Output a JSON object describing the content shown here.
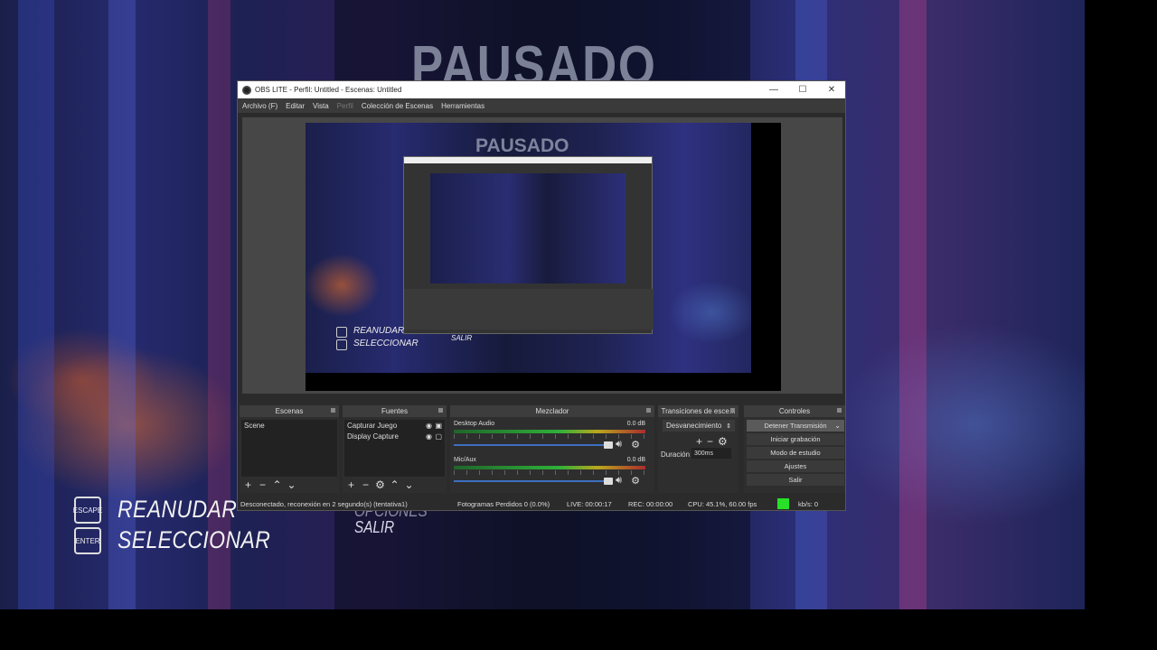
{
  "game": {
    "title": "PAUSADO",
    "menu": [
      {
        "key": "ESCAPE",
        "label": "REANUDAR"
      },
      {
        "key": "ENTER",
        "label": "SELECCIONAR"
      }
    ],
    "options_partial": "OPCIONES",
    "exit_label": "SALIR"
  },
  "obs": {
    "window_title": "OBS LITE - Perfil: Untitled - Escenas: Untitled",
    "window_controls": {
      "minimize": "—",
      "maximize": "☐",
      "close": "✕"
    },
    "menu": [
      {
        "label": "Archivo (F)",
        "enabled": true
      },
      {
        "label": "Editar",
        "enabled": true
      },
      {
        "label": "Vista",
        "enabled": true
      },
      {
        "label": "Perfil",
        "enabled": false
      },
      {
        "label": "Colección de Escenas",
        "enabled": true
      },
      {
        "label": "Herramientas",
        "enabled": true
      }
    ],
    "preview": {
      "title": "PAUSADO",
      "menu": [
        {
          "label": "REANUDAR"
        },
        {
          "label": "SELECCIONAR"
        }
      ],
      "exit_label": "SALIR"
    },
    "scenes": {
      "header": "Escenas",
      "items": [
        "Scene"
      ]
    },
    "sources": {
      "header": "Fuentes",
      "items": [
        "Capturar Juego",
        "Display Capture"
      ]
    },
    "mixer": {
      "header": "Mezclador",
      "channels": [
        {
          "name": "Desktop Audio",
          "db": "0.0 dB"
        },
        {
          "name": "Mic/Aux",
          "db": "0.0 dB"
        }
      ]
    },
    "transitions": {
      "header": "Transiciones de esce...",
      "selected": "Desvanecimiento",
      "duration_label": "Duración",
      "duration_value": "300ms"
    },
    "controls": {
      "header": "Controles",
      "buttons": [
        "Detener Transmisión",
        "Iniciar grabación",
        "Modo de estudio",
        "Ajustes",
        "Salir"
      ]
    },
    "status": {
      "connection": "Desconectado, reconexión en 2 segundo(s) (tentativa1)",
      "frames_lost": "Fotogramas Perdidos 0 (0.0%)",
      "live": "LIVE: 00:00:17",
      "rec": "REC: 00:00:00",
      "cpu": "CPU: 45.1%, 60.00 fps",
      "bitrate": "kb/s: 0",
      "indicator_color": "#27e027"
    }
  }
}
